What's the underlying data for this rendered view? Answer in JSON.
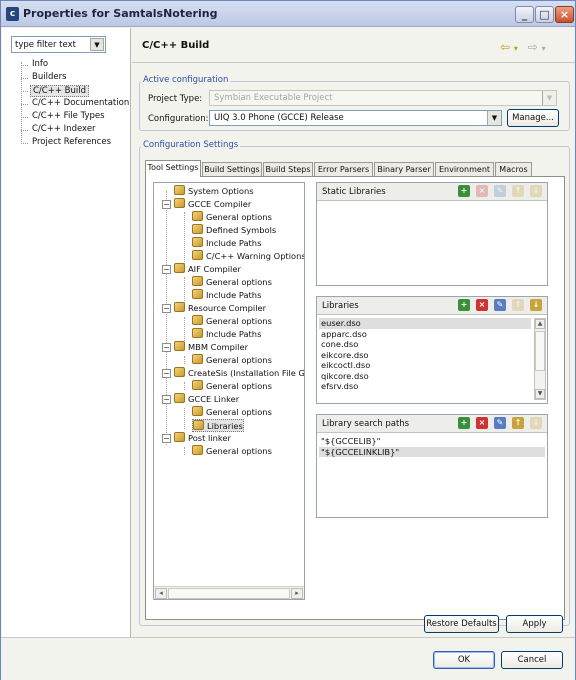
{
  "window": {
    "title": "Properties for SamtalsNotering",
    "app_icon_letter": "c"
  },
  "sidebar": {
    "filter_placeholder": "type filter text",
    "items": [
      {
        "label": "Info"
      },
      {
        "label": "Builders"
      },
      {
        "label": "C/C++ Build",
        "selected": true
      },
      {
        "label": "C/C++ Documentation"
      },
      {
        "label": "C/C++ File Types"
      },
      {
        "label": "C/C++ Indexer"
      },
      {
        "label": "Project References"
      }
    ]
  },
  "page": {
    "title": "C/C++ Build"
  },
  "active_configuration": {
    "group_label": "Active configuration",
    "project_type_label": "Project Type:",
    "project_type_value": "Symbian Executable Project",
    "configuration_label": "Configuration:",
    "configuration_value": "UIQ 3.0 Phone (GCCE) Release",
    "manage_button": "Manage..."
  },
  "configuration_settings": {
    "group_label": "Configuration Settings",
    "tabs": [
      {
        "label": "Tool Settings",
        "active": true
      },
      {
        "label": "Build Settings"
      },
      {
        "label": "Build Steps"
      },
      {
        "label": "Error Parsers"
      },
      {
        "label": "Binary Parser"
      },
      {
        "label": "Environment"
      },
      {
        "label": "Macros"
      }
    ],
    "tree": [
      "System Options",
      "GCCE Compiler",
      "General options",
      "Defined Symbols",
      "Include Paths",
      "C/C++ Warning Options",
      "AIF Compiler",
      "General options",
      "Include Paths",
      "Resource Compiler",
      "General options",
      "Include Paths",
      "MBM Compiler",
      "General options",
      "CreateSis (Installation File Gr",
      "General options",
      "GCCE Linker",
      "General options",
      "Libraries",
      "Post linker",
      "General options"
    ],
    "static_libraries": {
      "title": "Static Libraries",
      "items": []
    },
    "libraries": {
      "title": "Libraries",
      "items": [
        "euser.dso",
        "apparc.dso",
        "cone.dso",
        "eikcore.dso",
        "eikcoctl.dso",
        "qikcore.dso",
        "efsrv.dso"
      ]
    },
    "library_search_paths": {
      "title": "Library search paths",
      "items": [
        "\"${GCCELIB}\"",
        "\"${GCCELINKLIB}\""
      ]
    }
  },
  "buttons": {
    "restore_defaults": "Restore Defaults",
    "apply": "Apply",
    "ok": "OK",
    "cancel": "Cancel"
  },
  "colors": {
    "accent": "#2a4ea6",
    "window_bg": "#f3f3ee",
    "title_bar": "#c7d1ea",
    "close_button": "#c9522f"
  }
}
